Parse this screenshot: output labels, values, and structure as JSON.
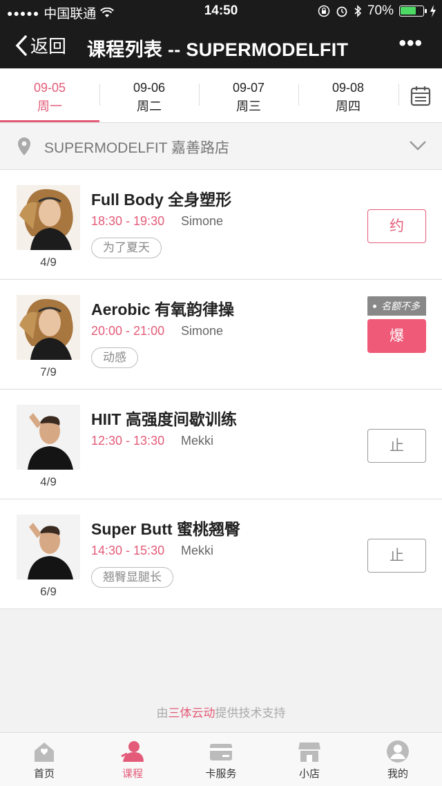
{
  "status_bar": {
    "carrier": "中国联通",
    "time": "14:50",
    "battery": "70%",
    "battery_level": 0.7
  },
  "nav": {
    "back_label": "返回",
    "title": "课程列表 -- SUPERMODELFIT",
    "more_label": "•••"
  },
  "dates": [
    {
      "date": "09-05",
      "weekday": "周一",
      "active": true
    },
    {
      "date": "09-06",
      "weekday": "周二",
      "active": false
    },
    {
      "date": "09-07",
      "weekday": "周三",
      "active": false
    },
    {
      "date": "09-08",
      "weekday": "周四",
      "active": false
    }
  ],
  "store": {
    "name": "SUPERMODELFIT 嘉善路店"
  },
  "courses": [
    {
      "name": "Full Body 全身塑形",
      "time": "18:30 - 19:30",
      "coach": "Simone",
      "tag": "为了夏天",
      "count": "4/9",
      "button": "约",
      "button_style": "outline-pink",
      "badge": ""
    },
    {
      "name": "Aerobic 有氧韵律操",
      "time": "20:00 - 21:00",
      "coach": "Simone",
      "tag": "动感",
      "count": "7/9",
      "button": "爆",
      "button_style": "solid-pink",
      "badge": "名额不多"
    },
    {
      "name": "HIIT 高强度间歇训练",
      "time": "12:30 - 13:30",
      "coach": "Mekki",
      "tag": "",
      "count": "4/9",
      "button": "止",
      "button_style": "outline-grey",
      "badge": ""
    },
    {
      "name": "Super Butt 蜜桃翘臀",
      "time": "14:30 - 15:30",
      "coach": "Mekki",
      "tag": "翘臀显腿长",
      "count": "6/9",
      "button": "止",
      "button_style": "outline-grey",
      "badge": ""
    }
  ],
  "footer_note": {
    "prefix": "由",
    "brand": "三体云动",
    "suffix": "提供技术支持"
  },
  "tabbar": [
    {
      "label": "首页",
      "icon": "home-icon",
      "active": false
    },
    {
      "label": "课程",
      "icon": "user-icon",
      "active": true
    },
    {
      "label": "卡服务",
      "icon": "card-icon",
      "active": false
    },
    {
      "label": "小店",
      "icon": "shop-icon",
      "active": false
    },
    {
      "label": "我的",
      "icon": "profile-icon",
      "active": false
    }
  ],
  "colors": {
    "accent": "#e35b78",
    "topbar": "#1b1b1b",
    "battery": "#4cd964"
  }
}
